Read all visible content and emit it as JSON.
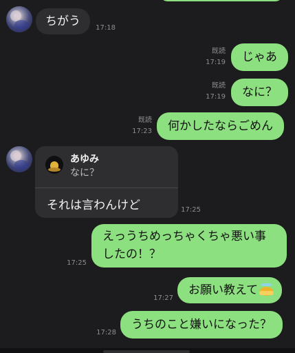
{
  "messages": {
    "m1": {
      "text": "ちがう",
      "time": "17:18"
    },
    "m2": {
      "text": "じゃあ",
      "read": "既読",
      "time": "17:19"
    },
    "m3": {
      "text": "なに？",
      "read": "既読",
      "time": "17:19"
    },
    "m4": {
      "text": "何かしたならごめん",
      "read": "既読",
      "time": "17:23"
    },
    "m5": {
      "reply_to_name": "あゆみ",
      "reply_to_text": "なに？",
      "text": "それは言わんけど",
      "time": "17:25"
    },
    "m6": {
      "line1": "えっうちめっちゃくちゃ悪い事",
      "line2": "したの！？",
      "time": "17:25"
    },
    "m7": {
      "text": "お願い教えて",
      "time": "17:27"
    },
    "m8": {
      "text": "うちのこと嫌いになった？",
      "time": "17:28"
    }
  },
  "icons": {
    "avatar": "contact-avatar",
    "reply_avatar": "reply-author-avatar",
    "emoji": "worried-pleading-emoji"
  },
  "colors": {
    "background": "#1c1c1e",
    "incoming_bubble": "#2e2e31",
    "outgoing_bubble": "#8de07f",
    "meta_text": "#8e8e93"
  }
}
